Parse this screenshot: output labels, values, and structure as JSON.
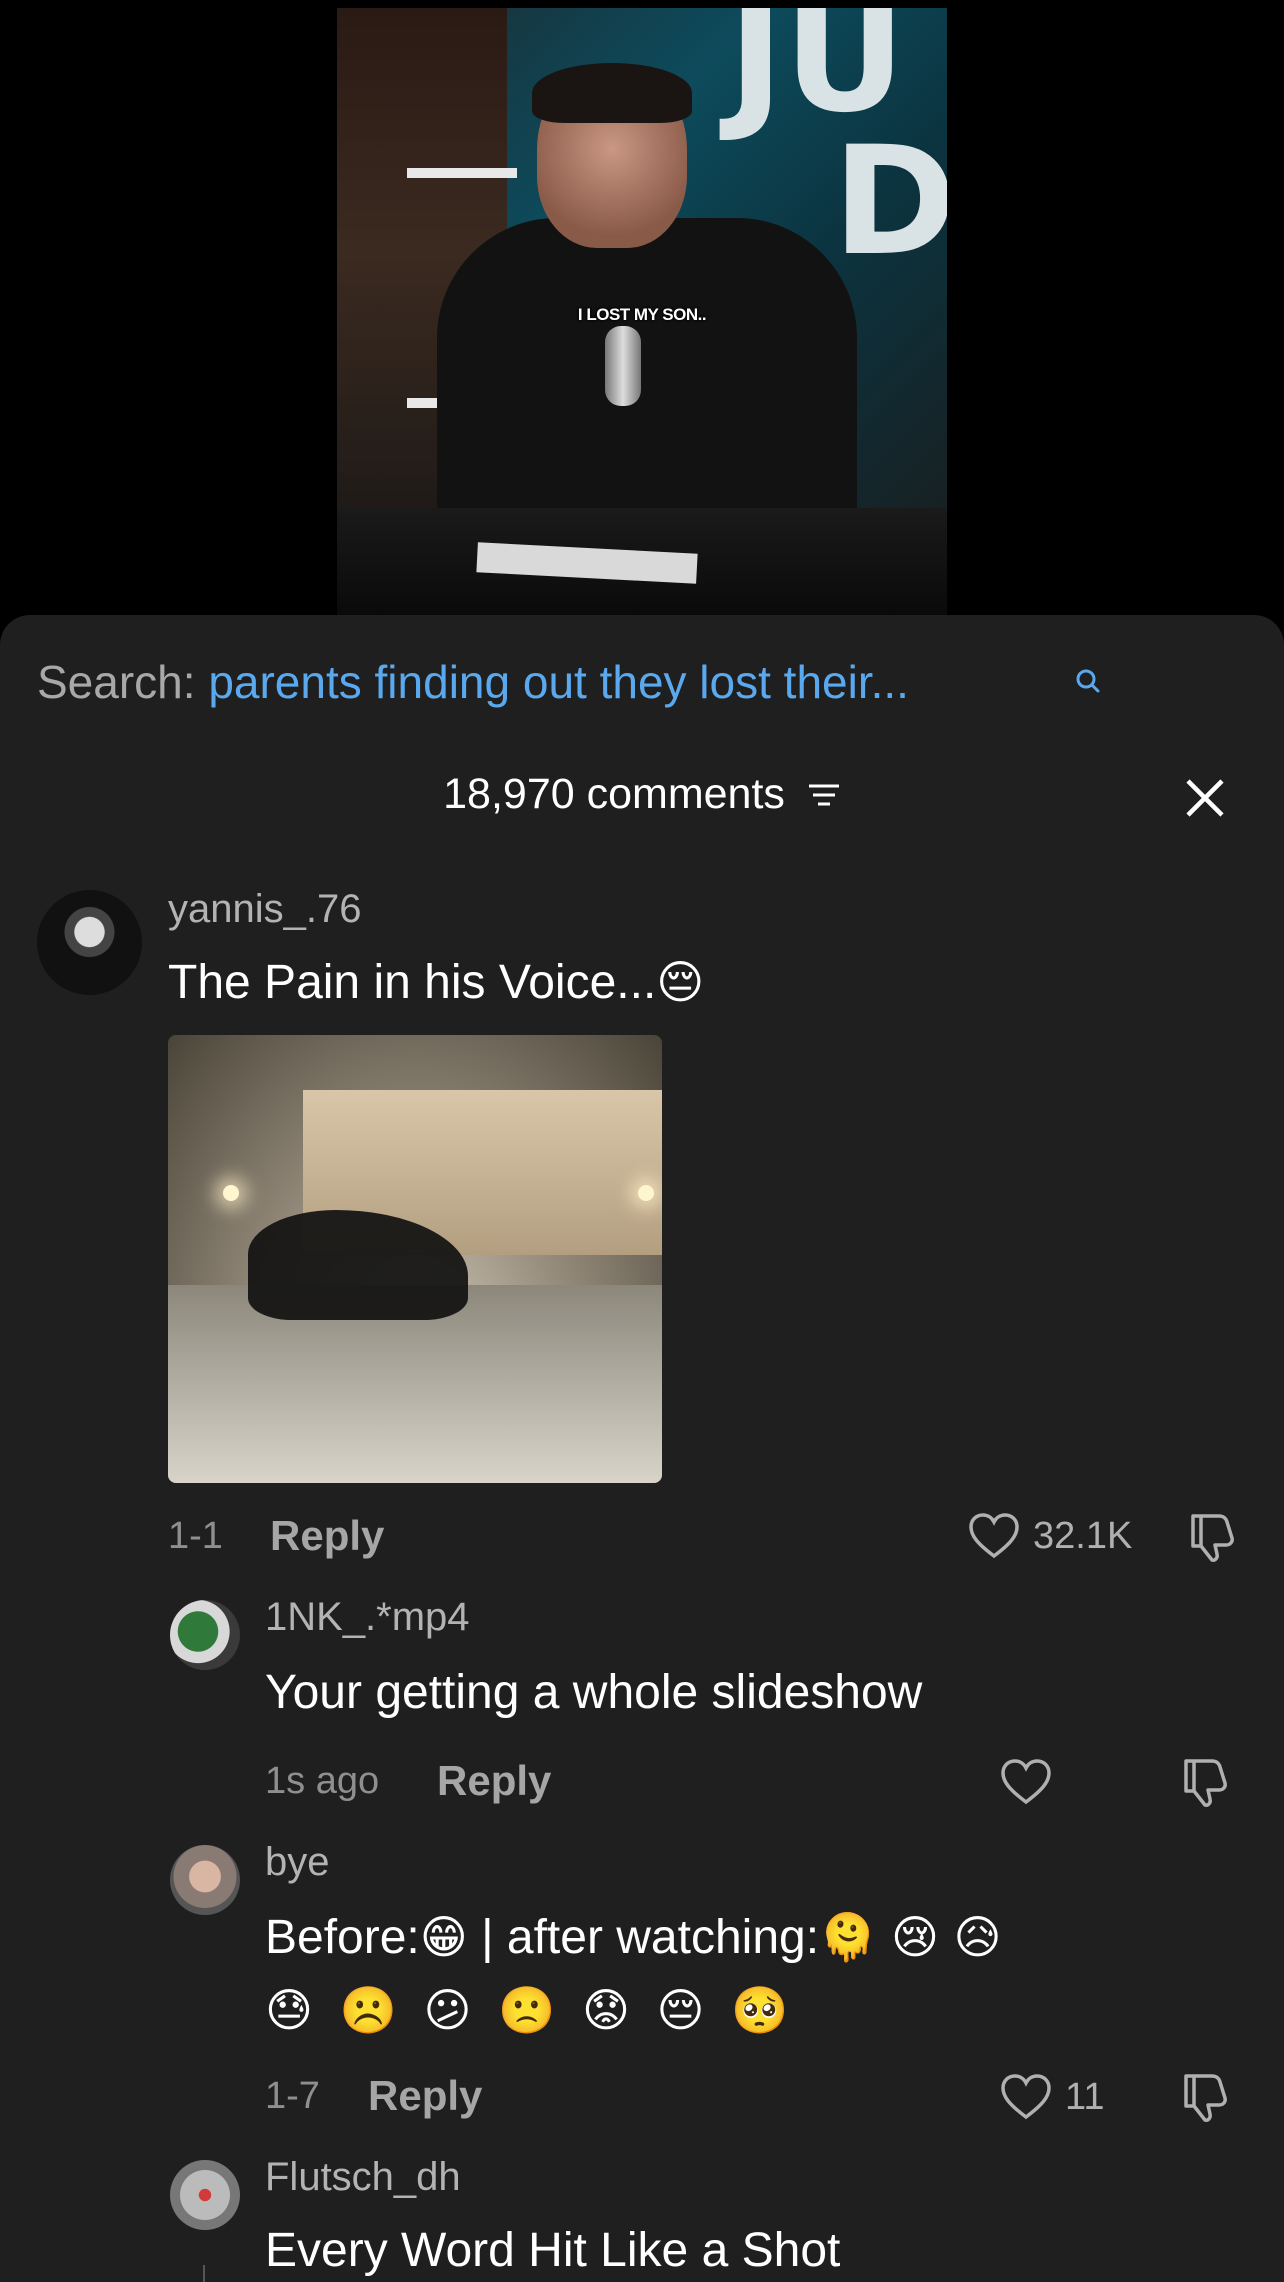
{
  "video": {
    "caption": "I LOST MY SON.."
  },
  "search": {
    "label": "Search:",
    "query": "parents finding out they lost their..."
  },
  "comments_header": {
    "count": "18,970 comments"
  },
  "comments": [
    {
      "user": "yannis_.76",
      "text": "The Pain in his Voice...",
      "emoji": "😔",
      "date": "1-1",
      "reply_label": "Reply",
      "likes": "32.1K"
    },
    {
      "user": "1NK_.*mp4",
      "text": "Your getting a whole slideshow",
      "date": "1s ago",
      "reply_label": "Reply",
      "likes": ""
    },
    {
      "user": "bye",
      "text_line1_a": "Before:",
      "emoji_a": "😁",
      "text_line1_b": " | after watching:",
      "emoji_line1": "🫠 😢 😥",
      "emoji_line2": "😓 ☹️ 😕 🙁 😟 😔 🥺",
      "date": "1-7",
      "reply_label": "Reply",
      "likes": "11"
    },
    {
      "user": "Flutsch_dh",
      "text": "Every Word Hit Like a Shot"
    }
  ],
  "icons": [
    "search-icon",
    "filter-icon",
    "close-icon",
    "heart-icon",
    "dislike-icon"
  ],
  "colors": {
    "background": "#1f1f1f",
    "link": "#5aa9ef",
    "muted": "#8f8f8f"
  }
}
